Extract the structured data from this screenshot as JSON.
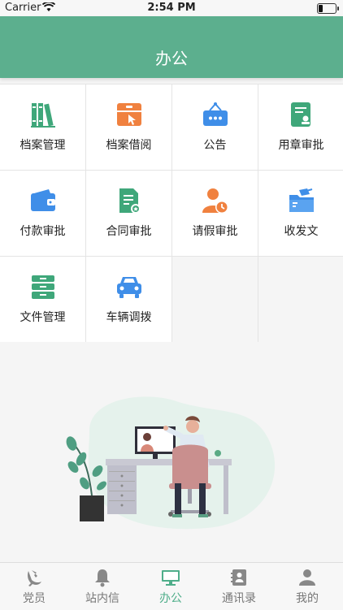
{
  "status_bar": {
    "carrier": "Carrier",
    "time": "2:54 PM"
  },
  "header": {
    "title": "办公"
  },
  "grid_items": [
    {
      "label": "档案管理",
      "icon": "archive-books-icon"
    },
    {
      "label": "档案借阅",
      "icon": "archive-borrow-icon"
    },
    {
      "label": "公告",
      "icon": "announcement-icon"
    },
    {
      "label": "用章审批",
      "icon": "seal-approval-icon"
    },
    {
      "label": "付款审批",
      "icon": "wallet-icon"
    },
    {
      "label": "合同审批",
      "icon": "contract-icon"
    },
    {
      "label": "请假审批",
      "icon": "leave-person-clock-icon"
    },
    {
      "label": "收发文",
      "icon": "folder-send-icon"
    },
    {
      "label": "文件管理",
      "icon": "file-cabinet-icon"
    },
    {
      "label": "车辆调拨",
      "icon": "car-icon"
    }
  ],
  "tabs": [
    {
      "label": "党员",
      "icon": "party-emblem-icon",
      "active": false
    },
    {
      "label": "站内信",
      "icon": "bell-icon",
      "active": false
    },
    {
      "label": "办公",
      "icon": "monitor-icon",
      "active": true
    },
    {
      "label": "通讯录",
      "icon": "contacts-icon",
      "active": false
    },
    {
      "label": "我的",
      "icon": "person-icon",
      "active": false
    }
  ],
  "colors": {
    "header": "#5caf8e",
    "active_tab": "#4fae8a",
    "icon_green": "#3fa77a",
    "icon_orange": "#f0813f",
    "icon_blue": "#3f8ee8"
  }
}
